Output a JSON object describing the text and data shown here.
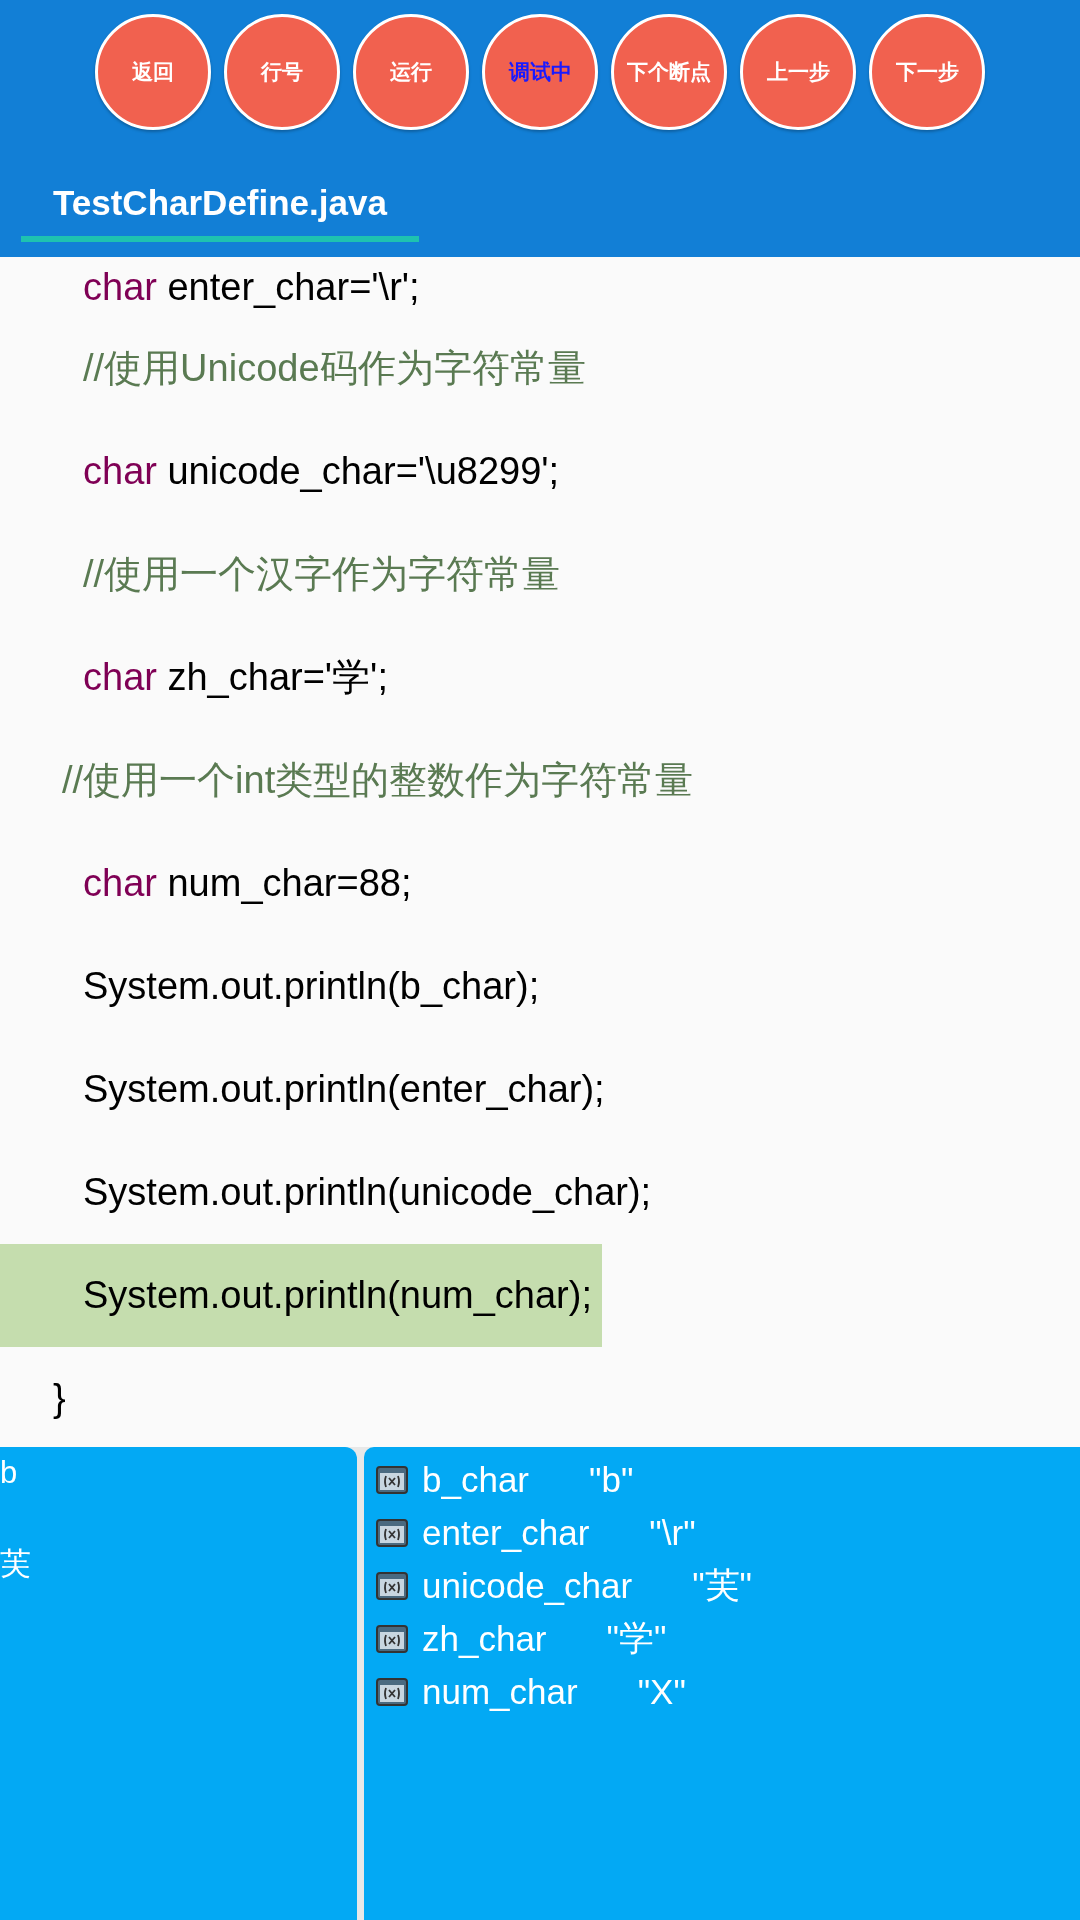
{
  "toolbar": {
    "buttons": [
      {
        "label": "返回",
        "active": false
      },
      {
        "label": "行号",
        "active": false
      },
      {
        "label": "运行",
        "active": false
      },
      {
        "label": "调试中",
        "active": true
      },
      {
        "label": "下个断点",
        "active": false
      },
      {
        "label": "上一步",
        "active": false
      },
      {
        "label": "下一步",
        "active": false
      }
    ]
  },
  "tabs": [
    {
      "label": "TestCharDefine.java",
      "selected": true
    }
  ],
  "code": {
    "lines": [
      {
        "kind": "decl",
        "keyword": "char",
        "text": "enter_char='\\r';",
        "selected": false
      },
      {
        "kind": "comment",
        "text": "//使用Unicode码作为字符常量",
        "selected": false
      },
      {
        "kind": "decl",
        "keyword": "char",
        "text": "unicode_char='\\u8299';",
        "selected": false
      },
      {
        "kind": "comment",
        "text": "//使用一个汉字作为字符常量",
        "selected": false
      },
      {
        "kind": "decl",
        "keyword": "char",
        "text": "zh_char='学';",
        "selected": false
      },
      {
        "kind": "outer_comment",
        "text": "//使用一个int类型的整数作为字符常量",
        "selected": false
      },
      {
        "kind": "decl",
        "keyword": "char",
        "text": "num_char=88;",
        "selected": false
      },
      {
        "kind": "statement",
        "text": "System.out.println(b_char);",
        "selected": false
      },
      {
        "kind": "statement",
        "text": "System.out.println(enter_char);",
        "selected": false
      },
      {
        "kind": "statement",
        "text": "System.out.println(unicode_char);",
        "selected": false
      },
      {
        "kind": "statement",
        "text": "System.out.println(num_char);",
        "selected": true
      },
      {
        "kind": "close_brace",
        "text": "}",
        "selected": false
      }
    ]
  },
  "console": {
    "lines": [
      "b",
      "芙"
    ]
  },
  "variables": [
    {
      "name": "b_char",
      "value": "\"b\""
    },
    {
      "name": "enter_char",
      "value": "\"\\r\""
    },
    {
      "name": "unicode_char",
      "value": "\"芙\""
    },
    {
      "name": "zh_char",
      "value": "\"学\""
    },
    {
      "name": "num_char",
      "value": "\"X\""
    }
  ]
}
